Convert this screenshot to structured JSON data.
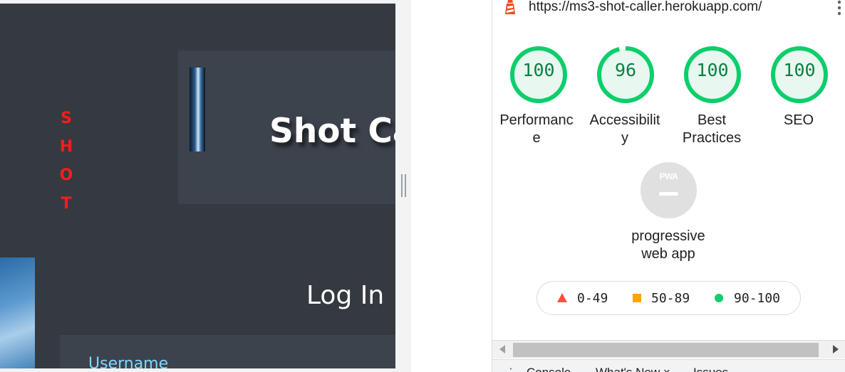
{
  "site": {
    "vertical_word": [
      "S",
      "H",
      "O",
      "T"
    ],
    "hero_title": "Shot Ca",
    "login_heading": "Log In",
    "username_label": "Username"
  },
  "devtools": {
    "url": "https://ms3-shot-caller.herokuapp.com/",
    "gauges": [
      {
        "score": "100",
        "label": "Performance",
        "fraction": 1.0
      },
      {
        "score": "96",
        "label": "Accessibility",
        "fraction": 0.96
      },
      {
        "score": "100",
        "label": "Best Practices",
        "fraction": 1.0
      },
      {
        "score": "100",
        "label": "SEO",
        "fraction": 1.0
      }
    ],
    "pwa": {
      "badge": "PWA",
      "label": "progressive web app"
    },
    "legend": [
      {
        "range": "0-49",
        "shape": "triangle",
        "color": "#ff4e42"
      },
      {
        "range": "50-89",
        "shape": "square",
        "color": "#ffa400"
      },
      {
        "range": "90-100",
        "shape": "circle",
        "color": "#0cce6b"
      }
    ],
    "drawer": {
      "menu_icon": "⋮",
      "tabs": [
        "Console",
        "What's New ×",
        "Issues"
      ]
    },
    "colors": {
      "pass": "#0cce6b",
      "pass_text": "#0b8043",
      "pass_fill": "#e8f7ef"
    }
  }
}
